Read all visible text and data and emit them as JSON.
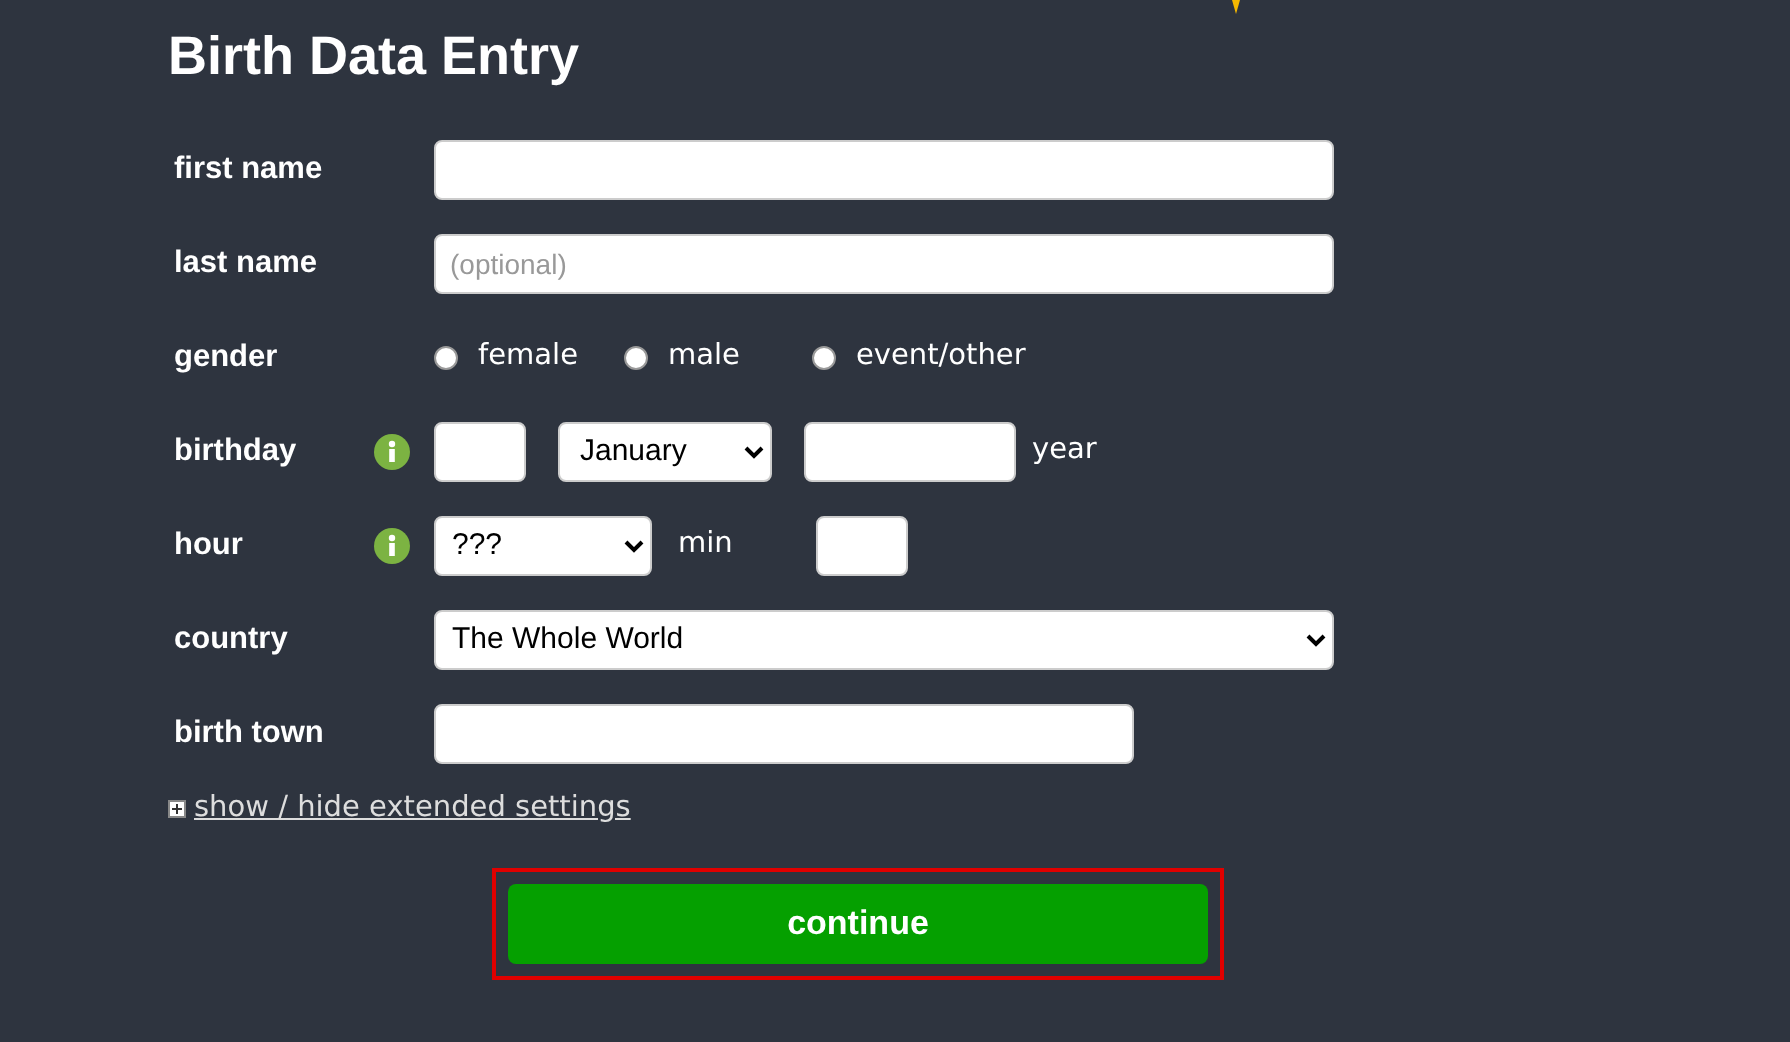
{
  "title": "Birth Data Entry",
  "fields": [
    {
      "kind": "text",
      "label": "first name"
    },
    {
      "kind": "text",
      "label": "last name",
      "placeholder": "(optional)"
    },
    {
      "kind": "radios",
      "label": "gender",
      "options": [
        {
          "label": "female",
          "selected": false
        },
        {
          "label": "male",
          "selected": false
        },
        {
          "label": "event/other",
          "selected": false
        }
      ]
    },
    {
      "kind": "date",
      "label": "birthday",
      "info": true,
      "month": "January",
      "suffix": "year"
    },
    {
      "kind": "time",
      "label": "hour",
      "info": true,
      "hour": "???",
      "suffix": "min"
    },
    {
      "kind": "select",
      "label": "country",
      "value": "The Whole World"
    },
    {
      "kind": "short_text",
      "label": "birth town"
    }
  ],
  "extended_link": "show / hide extended settings",
  "submit": {
    "label": "continue",
    "highlighted": true
  }
}
